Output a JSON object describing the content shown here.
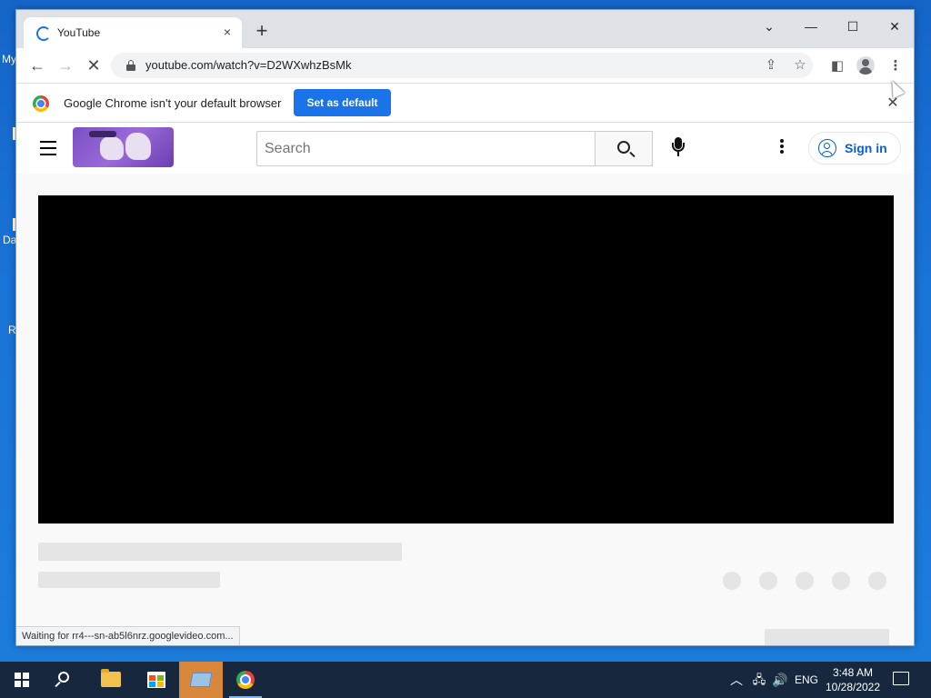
{
  "desktop": {
    "fragments": [
      "My",
      "Da",
      "R"
    ]
  },
  "browser": {
    "tab_title": "YouTube",
    "tab_close": "×",
    "new_tab": "+",
    "url": "youtube.com/watch?v=D2WXwhzBsMk",
    "window_controls": {
      "tab_search": "⌄",
      "minimize": "—",
      "maximize": "☐",
      "close": "✕"
    }
  },
  "infobar": {
    "message": "Google Chrome isn't your default browser",
    "button": "Set as default",
    "close": "✕"
  },
  "youtube": {
    "search_placeholder": "Search",
    "sign_in": "Sign in"
  },
  "status_text": "Waiting for rr4---sn-ab5l6nrz.googlevideo.com...",
  "taskbar": {
    "language": "ENG",
    "time": "3:48 AM",
    "date": "10/28/2022"
  },
  "colors": {
    "accent": "#1a73e8",
    "youtube_link": "#065fd4",
    "taskbar_bg": "#17283e",
    "active_task": "#d8873a"
  }
}
